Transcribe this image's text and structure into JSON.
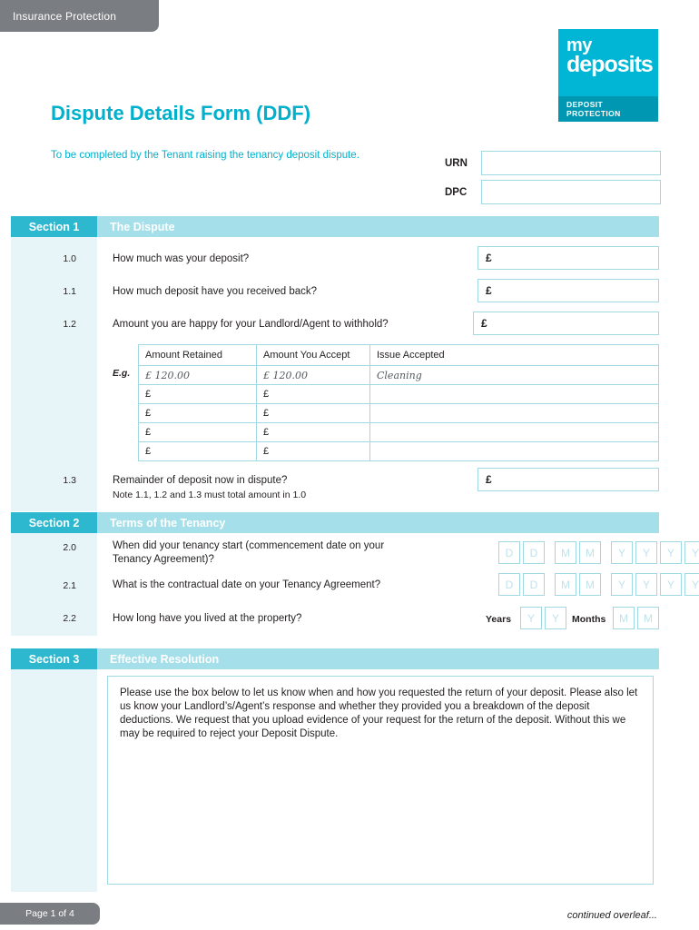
{
  "top_tab": {
    "label": "Insurance Protection"
  },
  "logo": {
    "line1": "my",
    "line2": "deposits",
    "strap": "DEPOSIT PROTECTION"
  },
  "header": {
    "title": "Dispute Details Form (DDF)",
    "subtitle": "To be completed by the Tenant raising the tenancy deposit dispute.",
    "urn_label": "URN",
    "urn_value": "",
    "dpc_label": "DPC",
    "dpc_value": ""
  },
  "sections": [
    {
      "tag": "Section 1",
      "title": "The Dispute"
    },
    {
      "tag": "Section 2",
      "title": "Terms of the Tenancy"
    },
    {
      "tag": "Section 3",
      "title": "Effective Resolution"
    }
  ],
  "section1": {
    "questions": [
      {
        "num": "1.0",
        "text": "How much was your deposit?",
        "currency": "£",
        "value": ""
      },
      {
        "num": "1.1",
        "text": "How much deposit have you received back?",
        "currency": "£",
        "value": ""
      },
      {
        "num": "1.2",
        "text": "Amount you are happy for your Landlord/Agent to withhold?",
        "currency": "£",
        "value": ""
      },
      {
        "num": "1.3",
        "text": "Remainder of deposit now in dispute?",
        "currency": "£",
        "value": ""
      }
    ],
    "note": "Note 1.1, 1.2 and 1.3 must total amount in 1.0",
    "table": {
      "eg_label": "E.g.",
      "headers": [
        "Amount Retained",
        "Amount You Accept",
        "Issue Accepted"
      ],
      "example_row": [
        "£ 120.00",
        "£ 120.00",
        "Cleaning"
      ],
      "blank_rows": [
        [
          "£",
          "£",
          ""
        ],
        [
          "£",
          "£",
          ""
        ],
        [
          "£",
          "£",
          ""
        ],
        [
          "£",
          "£",
          ""
        ]
      ]
    }
  },
  "section2": {
    "questions": [
      {
        "num": "2.0",
        "text_line1": "When did your tenancy start (commencement date on your",
        "text_line2": "Tenancy Agreement)?"
      },
      {
        "num": "2.1",
        "text_line1": "What is the contractual date on your Tenancy Agreement?",
        "text_line2": ""
      },
      {
        "num": "2.2",
        "text_line1": "How long have you lived at the property?",
        "text_line2": ""
      }
    ],
    "date_placeholders": [
      "D",
      "D",
      "M",
      "M",
      "Y",
      "Y",
      "Y",
      "Y"
    ],
    "years_label": "Years",
    "years_placeholders": [
      "Y",
      "Y"
    ],
    "months_label": "Months",
    "months_placeholders": [
      "M",
      "M"
    ]
  },
  "section3": {
    "body": "Please use the box below to let us know when and how you requested the return of your deposit. Please also let us know your Landlord’s/Agent’s response and whether they provided you a breakdown of the deposit deductions. We request that you upload evidence of your request for the return of the deposit. Without this we may be required to reject your Deposit Dispute.",
    "value": ""
  },
  "footer": {
    "page_label": "Page 1 of 4",
    "continued": "continued overleaf..."
  },
  "colors": {
    "brand": "#00b6d4",
    "section_tag": "#2eb8cf",
    "section_bar": "#a5dfe9",
    "border": "#9ed9e4",
    "rail": "#e8f5f8",
    "grey_tab": "#7a7d81"
  }
}
